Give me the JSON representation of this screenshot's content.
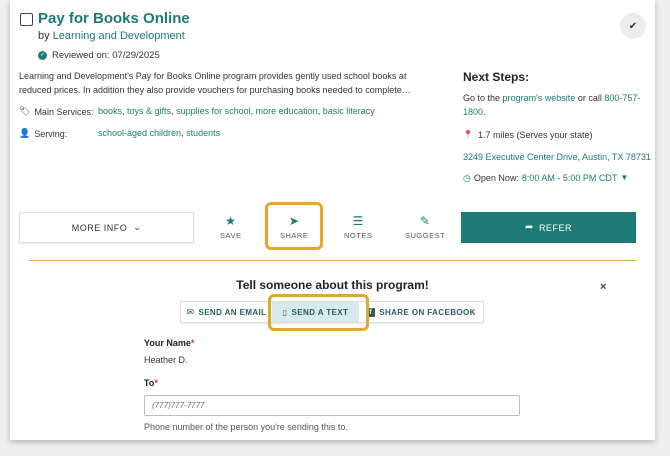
{
  "program": {
    "title": "Pay for Books Online",
    "by_prefix": "by",
    "provider": "Learning and Development",
    "reviewed": "Reviewed on: 07/29/2025",
    "description": "Learning and Development's Pay for Books Online program provides gently used school books at reduced prices. In addition they also provide vouchers for purchasing books needed to complete…"
  },
  "services": {
    "label": "Main Services:",
    "items": [
      "books",
      "toys & gifts",
      "supplies for school",
      "more education",
      "basic literacy"
    ]
  },
  "serving": {
    "label": "Serving:",
    "items": [
      "school-aged children",
      "students"
    ]
  },
  "next_steps": {
    "heading": "Next Steps:",
    "goto_prefix": "Go to the",
    "website_link": "program's website",
    "or_call": "or call",
    "phone": "800-757-1800",
    "period": ".",
    "distance": "1.7 miles (Serves your state)",
    "address": "3249 Executive Center Drive, Austin, TX 78731",
    "open_now_label": "Open Now:",
    "hours": "8:00 AM - 5:00 PM CDT"
  },
  "actions": {
    "more_info": "MORE INFO",
    "save": "SAVE",
    "share": "SHARE",
    "notes": "NOTES",
    "suggest": "SUGGEST",
    "refer": "REFER"
  },
  "share_panel": {
    "heading": "Tell someone about this program!",
    "close": "×",
    "tabs": [
      {
        "label": "SEND AN EMAIL",
        "icon": "envelope-icon"
      },
      {
        "label": "SEND A TEXT",
        "icon": "mobile-phone-icon",
        "active": true
      },
      {
        "label": "SHARE ON FACEBOOK",
        "icon": "facebook-icon"
      }
    ],
    "your_name_label": "Your Name",
    "your_name_value": "Heather D.",
    "to_label": "To",
    "to_placeholder": "(777)777-7777",
    "to_help": "Phone number of the person you're sending this to."
  },
  "colors": {
    "brand_teal": "#1c7a77",
    "highlight_gold": "#e3a82b",
    "required_red": "#c0392b"
  }
}
